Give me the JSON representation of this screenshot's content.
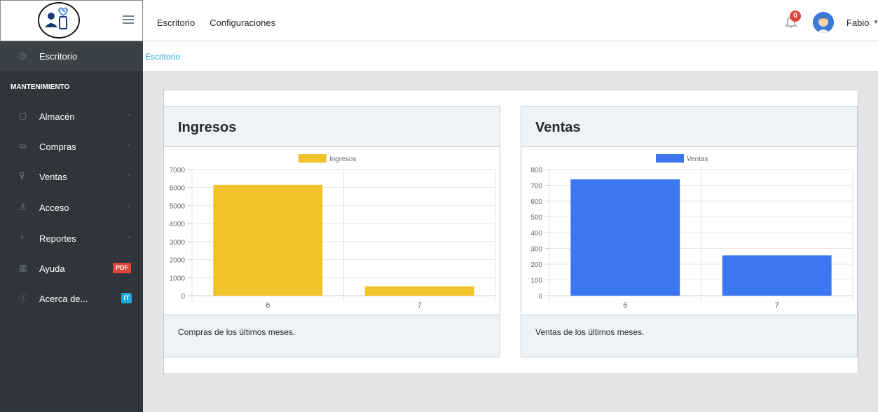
{
  "header": {
    "nav": [
      "Escritorio",
      "Configuraciones"
    ],
    "notifications_count": "0",
    "user_name": "Fabio"
  },
  "sidebar": {
    "section_title": "MANTENIMIENTO",
    "items": [
      {
        "label": "Escritorio",
        "icon": "speedometer-icon"
      },
      {
        "label": "Almacén",
        "icon": "clipboard-icon"
      },
      {
        "label": "Compras",
        "icon": "folder-icon"
      },
      {
        "label": "Ventas",
        "icon": "cart-icon"
      },
      {
        "label": "Acceso",
        "icon": "users-icon"
      },
      {
        "label": "Reportes",
        "icon": "pie-chart-icon"
      },
      {
        "label": "Ayuda",
        "icon": "book-icon",
        "badge": "PDF"
      },
      {
        "label": "Acerca de...",
        "icon": "info-icon",
        "badge": "IT"
      }
    ]
  },
  "breadcrumb": "Escritorio",
  "cards": [
    {
      "title": "Ingresos",
      "footer": "Compras de los últimos meses."
    },
    {
      "title": "Ventas",
      "footer": "Ventas de los últimos meses."
    }
  ],
  "colors": {
    "ingresos": "#f1c229",
    "ventas": "#3a77f0"
  },
  "chart_data": [
    {
      "type": "bar",
      "categories": [
        "6",
        "7"
      ],
      "series": [
        {
          "name": "Ingresos",
          "values": [
            6150,
            520
          ]
        }
      ],
      "ylim": [
        0,
        7000
      ],
      "yticks": [
        0,
        1000,
        2000,
        3000,
        4000,
        5000,
        6000,
        7000
      ],
      "legend": "top-center",
      "grid": true
    },
    {
      "type": "bar",
      "categories": [
        "6",
        "7"
      ],
      "series": [
        {
          "name": "Ventas",
          "values": [
            738,
            256
          ]
        }
      ],
      "ylim": [
        0,
        800
      ],
      "yticks": [
        0,
        100,
        200,
        300,
        400,
        500,
        600,
        700,
        800
      ],
      "legend": "top-center",
      "grid": true
    }
  ]
}
